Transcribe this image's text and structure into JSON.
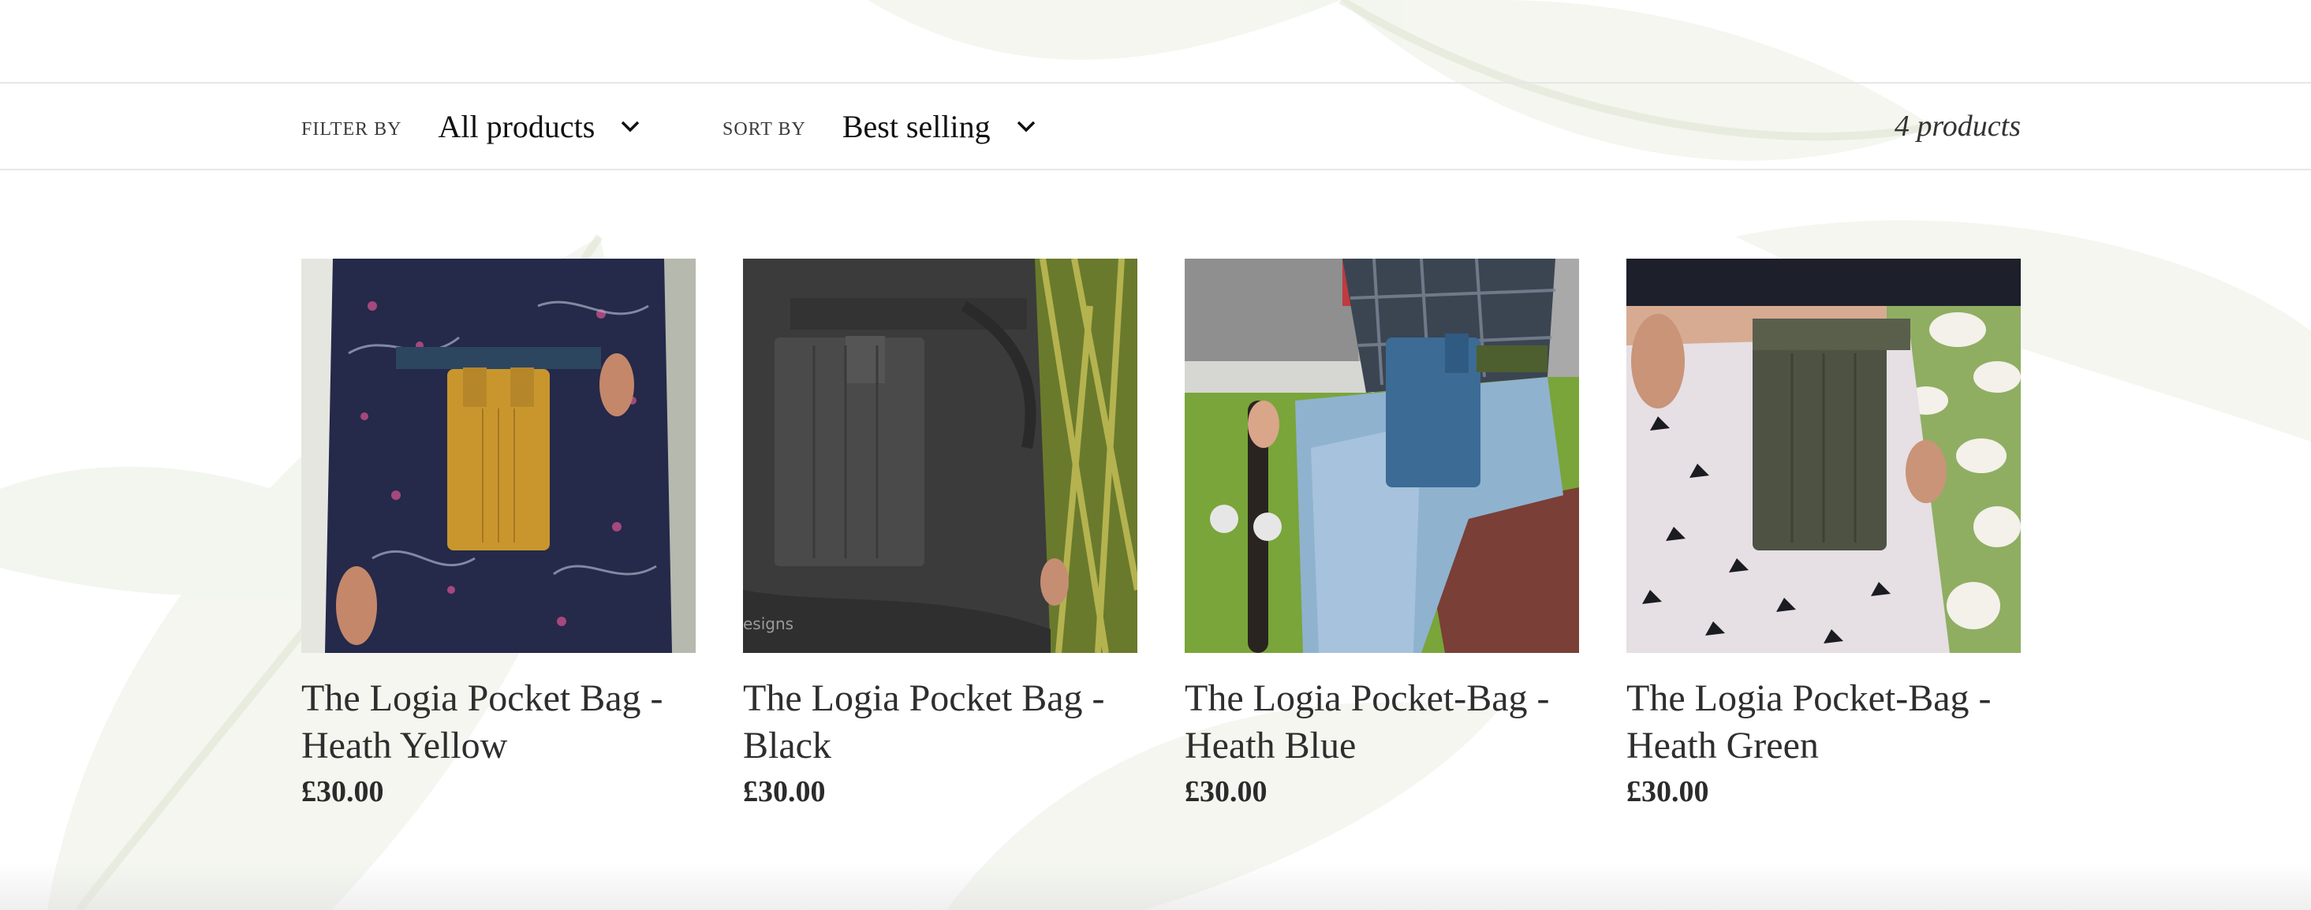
{
  "toolbar": {
    "filter_label": "Filter by",
    "filter_value": "All products",
    "sort_label": "Sort by",
    "sort_value": "Best selling",
    "count": "4 products"
  },
  "products": [
    {
      "title": "The Logia Pocket Bag - Heath Yellow",
      "price": "£30.00",
      "image": "yellow-pocket-bag-photo"
    },
    {
      "title": "The Logia Pocket Bag - Black",
      "price": "£30.00",
      "image": "black-pocket-bag-photo",
      "watermark": "esigns"
    },
    {
      "title": "The Logia Pocket-Bag - Heath Blue",
      "price": "£30.00",
      "image": "blue-pocket-bag-photo"
    },
    {
      "title": "The Logia Pocket-Bag - Heath Green",
      "price": "£30.00",
      "image": "green-pocket-bag-photo"
    }
  ],
  "colors": {
    "yellow_bag": "#c9962e",
    "black_bag": "#3f3f3f",
    "blue_bag": "#3c6b96",
    "green_bag": "#4d5243"
  }
}
